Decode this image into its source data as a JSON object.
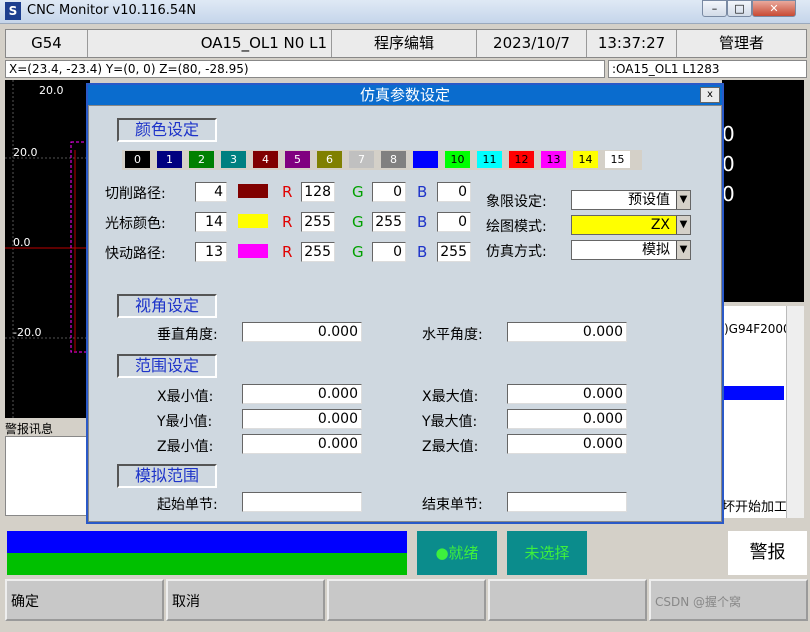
{
  "window": {
    "title": "CNC Monitor v10.116.54N",
    "icon_letter": "S",
    "min": "–",
    "max": "□",
    "close": "✕"
  },
  "header": [
    "G54",
    "OA15_OL1 N0 L1",
    "程序编辑",
    "2023/10/7",
    "13:37:27",
    "管理者"
  ],
  "coords": "X=(23.4, -23.4) Y=(0, 0) Z=(80, -28.95)",
  "program_line": ":OA15_OL1 L1283",
  "plot": {
    "labels": [
      "20.0",
      "20.0",
      "0.0",
      "-20.0"
    ]
  },
  "right_panel": {
    "numbers": [
      "0",
      "0",
      "0"
    ],
    "gcode": ")G94F2000",
    "footer": "坏开始加工"
  },
  "alarm_label": "警报讯息",
  "status": {
    "ready": "●就绪",
    "unselected": "未选择",
    "alarm_button": "警报"
  },
  "softkeys": [
    "确定",
    "取消",
    "",
    "",
    "",
    ""
  ],
  "dialog": {
    "title": "仿真参数设定",
    "close": "x",
    "sections": {
      "color": "颜色设定",
      "view": "视角设定",
      "range": "范围设定",
      "sim_range": "模拟范围"
    },
    "palette": [
      {
        "n": "0",
        "c": "#000000",
        "t": "#ffffff"
      },
      {
        "n": "1",
        "c": "#000080",
        "t": "#ffffff"
      },
      {
        "n": "2",
        "c": "#008000",
        "t": "#ffffff"
      },
      {
        "n": "3",
        "c": "#008080",
        "t": "#ffffff"
      },
      {
        "n": "4",
        "c": "#800000",
        "t": "#ffffff"
      },
      {
        "n": "5",
        "c": "#800080",
        "t": "#ffffff"
      },
      {
        "n": "6",
        "c": "#808000",
        "t": "#ffffff"
      },
      {
        "n": "7",
        "c": "#c0c0c0",
        "t": "#ffffff"
      },
      {
        "n": "8",
        "c": "#808080",
        "t": "#ffffff"
      },
      {
        "n": "9",
        "c": "#0000ff",
        "t": "#0000ff"
      },
      {
        "n": "10",
        "c": "#00ff00",
        "t": "#000000"
      },
      {
        "n": "11",
        "c": "#00ffff",
        "t": "#000000"
      },
      {
        "n": "12",
        "c": "#ff0000",
        "t": "#000000"
      },
      {
        "n": "13",
        "c": "#ff00ff",
        "t": "#000000"
      },
      {
        "n": "14",
        "c": "#ffff00",
        "t": "#000000"
      },
      {
        "n": "15",
        "c": "#ffffff",
        "t": "#000000"
      }
    ],
    "color_rows": [
      {
        "label": "切削路径:",
        "index": "4",
        "swatch": "#800000",
        "r": "128",
        "g": "0",
        "b": "0"
      },
      {
        "label": "光标颜色:",
        "index": "14",
        "swatch": "#ffff00",
        "r": "255",
        "g": "255",
        "b": "0"
      },
      {
        "label": "快动路径:",
        "index": "13",
        "swatch": "#ff00ff",
        "r": "255",
        "g": "0",
        "b": "255"
      }
    ],
    "rgb_labels": {
      "r": "R",
      "g": "G",
      "b": "B"
    },
    "options": [
      {
        "label": "象限设定:",
        "value": "预设值",
        "bg": "#ffffff"
      },
      {
        "label": "绘图模式:",
        "value": "ZX",
        "bg": "#ffff00"
      },
      {
        "label": "仿真方式:",
        "value": "模拟",
        "bg": "#ffffff"
      }
    ],
    "view": {
      "vertical_label": "垂直角度:",
      "vertical": "0.000",
      "horizontal_label": "水平角度:",
      "horizontal": "0.000"
    },
    "range": [
      {
        "min_label": "X最小值:",
        "min": "0.000",
        "max_label": "X最大值:",
        "max": "0.000"
      },
      {
        "min_label": "Y最小值:",
        "min": "0.000",
        "max_label": "Y最大值:",
        "max": "0.000"
      },
      {
        "min_label": "Z最小值:",
        "min": "0.000",
        "max_label": "Z最大值:",
        "max": "0.000"
      }
    ],
    "sim": {
      "start_label": "起始单节:",
      "start": "",
      "end_label": "结束单节:",
      "end": ""
    }
  },
  "watermark": "CSDN @握个窝"
}
